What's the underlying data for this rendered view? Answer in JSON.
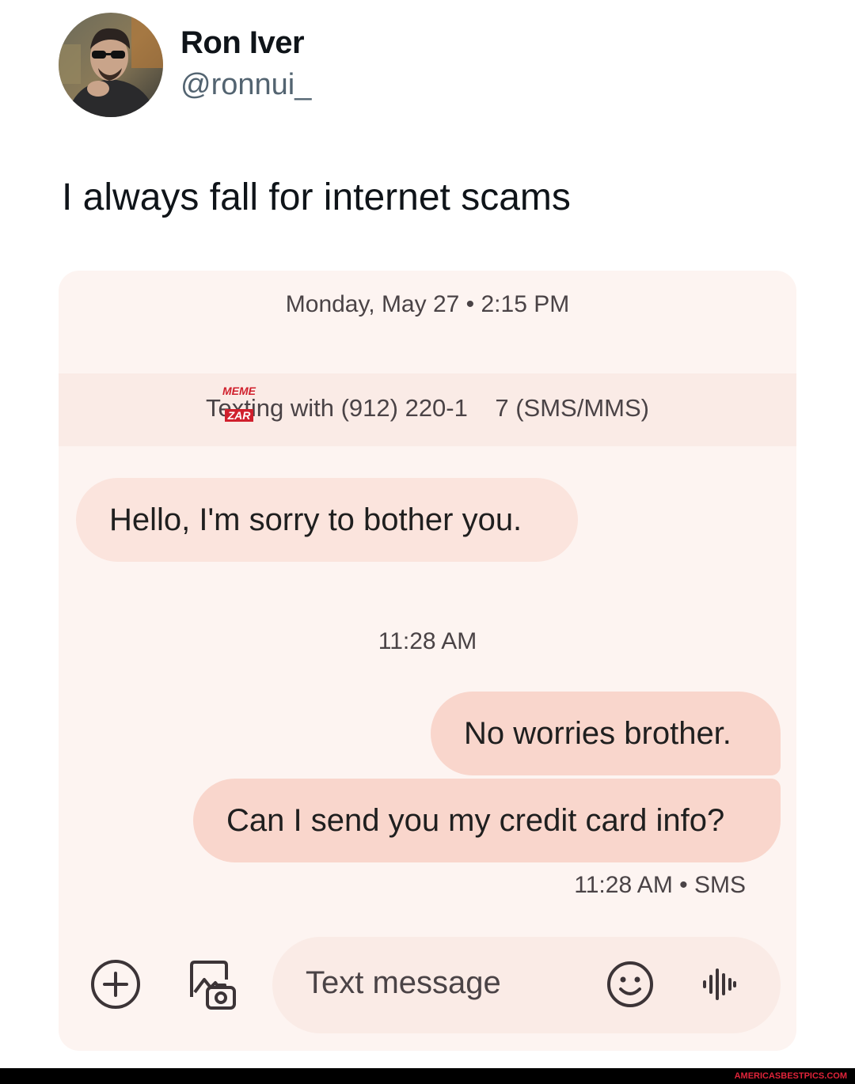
{
  "tweet": {
    "author_name": "Ron Iver",
    "author_handle": "@ronnui_",
    "text": "I always fall for internet scams"
  },
  "conversation": {
    "date_header": "Monday, May 27 • 2:15 PM",
    "texting_prefix": "Texting with (912) 220-1",
    "texting_digit_suffix": "7",
    "texting_suffix": "(SMS/MMS)",
    "watermark_top": "MEME",
    "watermark_bottom": "ZAR",
    "messages": [
      {
        "direction": "incoming",
        "text": "Hello, I'm sorry to bother you."
      },
      {
        "direction": "outgoing",
        "text": "No worries brother."
      },
      {
        "direction": "outgoing",
        "text": "Can I send you my credit card info?"
      }
    ],
    "timestamp_center": "11:28 AM",
    "timestamp_status": "11:28 AM • SMS"
  },
  "composer": {
    "placeholder": "Text message",
    "icons": [
      "add-icon",
      "gallery-icon",
      "emoji-icon",
      "voice-icon"
    ]
  },
  "footer": {
    "watermark": "AMERICASBESTPICS.COM"
  },
  "colors": {
    "panel_background": "#fdf4f1",
    "incoming_bubble": "#fbe4dd",
    "outgoing_bubble": "#f9d6cc",
    "secondary_text": "#4a4346",
    "handle_text": "#536471",
    "watermark_red": "#d0202d"
  }
}
